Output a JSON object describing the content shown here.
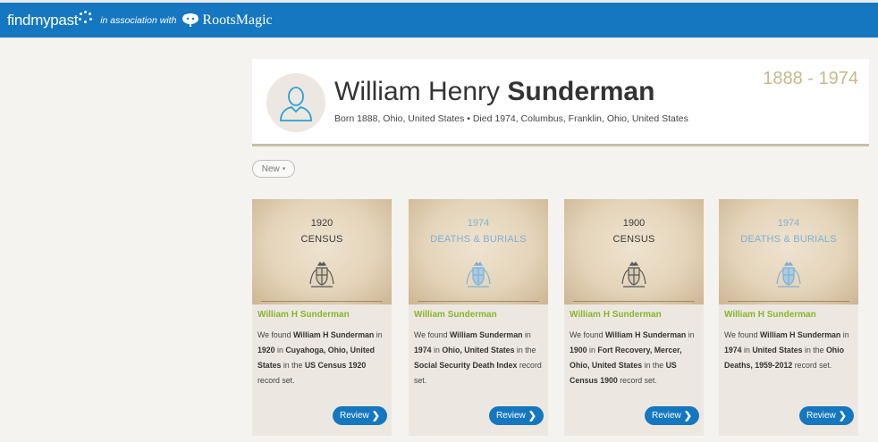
{
  "header": {
    "brand_findmypast": "findmypast",
    "association": "in association with",
    "brand_rootsmagic": "RootsMagic"
  },
  "person": {
    "first_names": "William Henry",
    "surname": "Sunderman",
    "life_summary": "Born 1888, Ohio, United States • Died 1974, Columbus, Franklin, Ohio, United States",
    "years": "1888 - 1974"
  },
  "filter": {
    "label": "New",
    "caret": "▾"
  },
  "cards": [
    {
      "year": "1920",
      "record_type": "CENSUS",
      "style": "dark",
      "name": "William H Sunderman",
      "d1": "We found ",
      "name_bold": "William H Sunderman",
      "d2": " in ",
      "year_bold": "1920",
      "d3": " in ",
      "place_bold": "Cuyahoga, Ohio, United States",
      "d4": " in the ",
      "set_bold": "US Census 1920",
      "d5": " record set.",
      "review_label": "Review"
    },
    {
      "year": "1974",
      "record_type": "DEATHS & BURIALS",
      "style": "blue",
      "name": "William Sunderman",
      "d1": "We found ",
      "name_bold": "William Sunderman",
      "d2": " in ",
      "year_bold": "1974",
      "d3": " in ",
      "place_bold": "Ohio, United States",
      "d4": " in the ",
      "set_bold": "Social Security Death Index",
      "d5": " record set.",
      "review_label": "Review"
    },
    {
      "year": "1900",
      "record_type": "CENSUS",
      "style": "dark",
      "name": "William H Sunderman",
      "d1": "We found ",
      "name_bold": "William H Sunderman",
      "d2": " in ",
      "year_bold": "1900",
      "d3": " in ",
      "place_bold": "Fort Recovery, Mercer, Ohio, United States",
      "d4": " in the ",
      "set_bold": "US Census 1900",
      "d5": " record set.",
      "review_label": "Review"
    },
    {
      "year": "1974",
      "record_type": "DEATHS & BURIALS",
      "style": "blue",
      "name": "William H Sunderman",
      "d1": "We found ",
      "name_bold": "William H Sunderman",
      "d2": " in ",
      "year_bold": "1974",
      "d3": " in ",
      "place_bold": "United States",
      "d4": " in the ",
      "set_bold": "Ohio Deaths, 1959-2012",
      "d5": " record set.",
      "review_label": "Review"
    }
  ],
  "colors": {
    "header_blue": "#1477bf",
    "name_green": "#8ab42c",
    "years_gold": "#c8b88a",
    "button_blue": "#1477bf"
  },
  "icons": {
    "avatar": "person-outline-icon",
    "brand_dots": "sparkle-dots-icon",
    "rootsmagic": "tree-logo-icon",
    "crest": "royal-crest-icon",
    "review": "chevron-right-icon",
    "dropdown": "caret-down-icon"
  }
}
